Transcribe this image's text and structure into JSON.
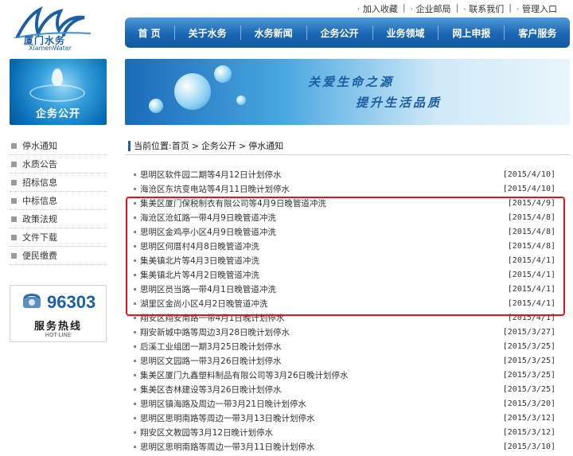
{
  "brand": {
    "name_cn": "厦门水务",
    "name_en": "XiamenWater"
  },
  "top_links": [
    "加入收藏",
    "企业邮局",
    "联系我们",
    "管理入口"
  ],
  "nav": [
    "首 页",
    "关于水务",
    "水务新闻",
    "企务公开",
    "业务领域",
    "网上申报",
    "客户服务"
  ],
  "left_banner": {
    "caption": "企务公开"
  },
  "right_banner": {
    "slogan1": "关爱生命之源",
    "slogan2": "提升生活品质"
  },
  "sidebar": {
    "items": [
      "停水通知",
      "水质公告",
      "招标信息",
      "中标信息",
      "政策法规",
      "文件下载",
      "便民缴费"
    ]
  },
  "hotline": {
    "number": "96303",
    "title": "服务热线",
    "subtitle": "HOT-LINE"
  },
  "breadcrumb": {
    "label": "当前位置:",
    "items": [
      "首页",
      "企务公开",
      "停水通知"
    ],
    "sep": ">"
  },
  "notices": [
    {
      "title": "思明区软件园二期等4月12日计划停水",
      "date": "[2015/4/10]"
    },
    {
      "title": "海沧区东坑变电站等4月11日晚计划停水",
      "date": "[2015/4/10]"
    },
    {
      "title": "集美区厦门保税制衣有限公司等4月9日晚管道冲洗",
      "date": "[2015/4/9]"
    },
    {
      "title": "海沧区沧虹路一带4月9日晚管道冲洗",
      "date": "[2015/4/8]"
    },
    {
      "title": "思明区金鸡亭小区4月9日晚管道冲洗",
      "date": "[2015/4/8]"
    },
    {
      "title": "思明区何厝村4月8日晚管道冲洗",
      "date": "[2015/4/8]"
    },
    {
      "title": "集美镇北片等4月3日晚管道冲洗",
      "date": "[2015/4/1]"
    },
    {
      "title": "集美镇北片等4月2日晚管道冲洗",
      "date": "[2015/4/1]"
    },
    {
      "title": "思明区员当路一带4月1日晚管道冲洗",
      "date": "[2015/4/1]"
    },
    {
      "title": "湖里区金尚小区4月2日晚管道冲洗",
      "date": "[2015/4/1]"
    },
    {
      "title": "翔安区翔安南路一带4月1日晚计划停水",
      "date": "[2015/4/1]"
    },
    {
      "title": "翔安新城中路等周边3月28日晚计划停水",
      "date": "[2015/3/27]"
    },
    {
      "title": "后溪工业组团一期3月25日晚计划停水",
      "date": "[2015/3/25]"
    },
    {
      "title": "思明区文园路一带3月26日晚计划停水",
      "date": "[2015/3/25]"
    },
    {
      "title": "集美区厦门九鑫塑料制品有限公司等3月26日晚计划停水",
      "date": "[2015/3/25]"
    },
    {
      "title": "集美区杏林建设等3月26日晚计划停水",
      "date": "[2015/3/25]"
    },
    {
      "title": "思明区镇海路及周边一带3月21日晚计划停水",
      "date": "[2015/3/20]"
    },
    {
      "title": "思明区思明南路等周边一带3月13日晚计划停水",
      "date": "[2015/3/12]"
    },
    {
      "title": "翔安区文教园等3月12日晚计划停水",
      "date": "[2015/3/12]"
    },
    {
      "title": "思明区思明南路等周边一带3月11日晚计划停水",
      "date": "[2015/3/10]"
    }
  ],
  "colors": {
    "nav_blue": "#1a66b3",
    "highlight_red": "#e0141c",
    "link_blue": "#1d5fa5"
  }
}
